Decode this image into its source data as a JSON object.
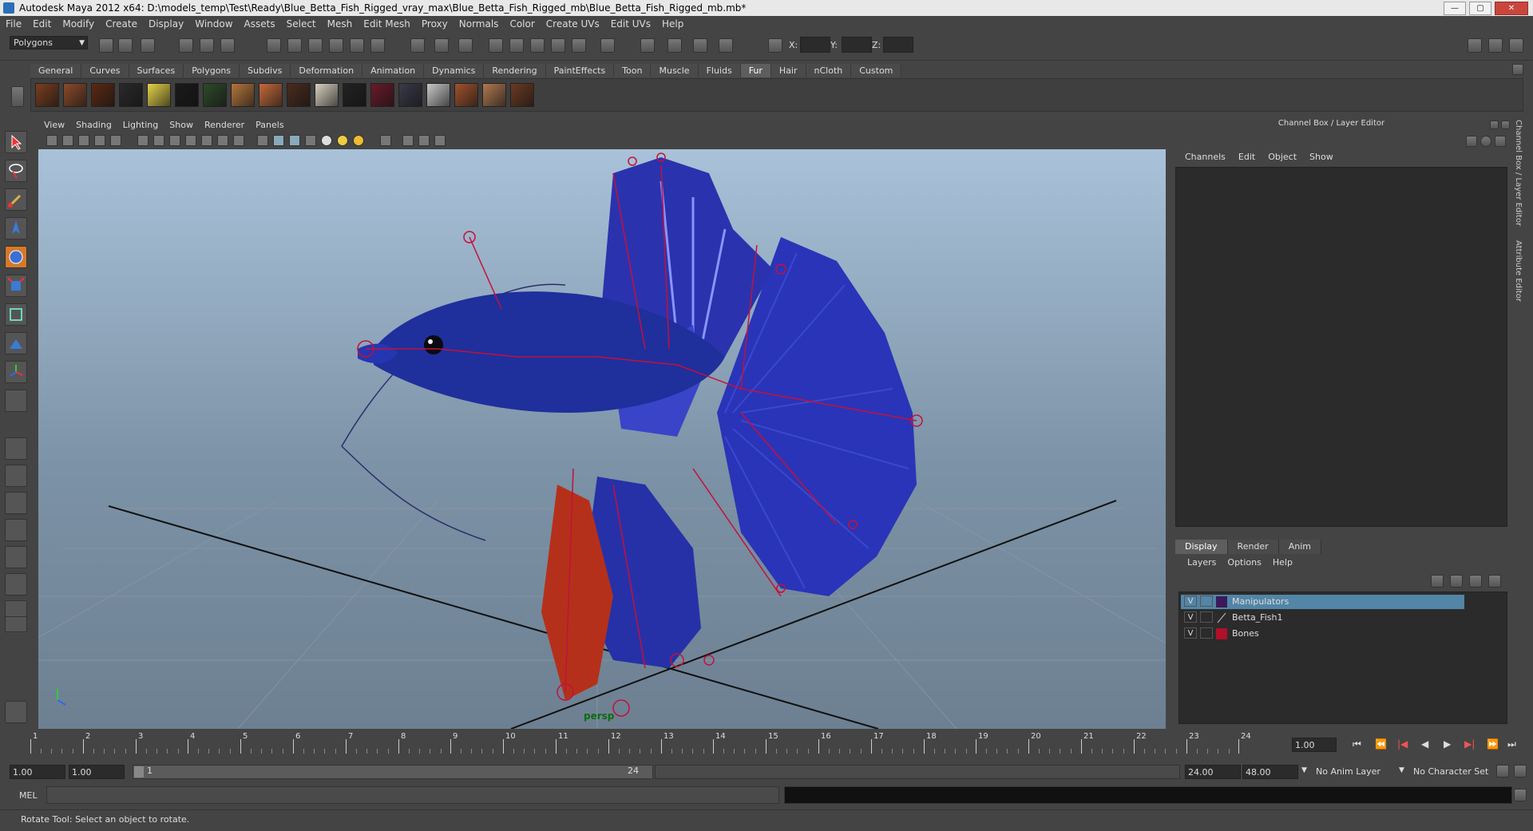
{
  "window": {
    "title": "Autodesk Maya 2012 x64: D:\\models_temp\\Test\\Ready\\Blue_Betta_Fish_Rigged_vray_max\\Blue_Betta_Fish_Rigged_mb\\Blue_Betta_Fish_Rigged_mb.mb*",
    "minimize": "—",
    "maximize": "▢",
    "close": "✕"
  },
  "menubar": [
    "File",
    "Edit",
    "Modify",
    "Create",
    "Display",
    "Window",
    "Assets",
    "Select",
    "Mesh",
    "Edit Mesh",
    "Proxy",
    "Normals",
    "Color",
    "Create UVs",
    "Edit UVs",
    "Help"
  ],
  "status_line": {
    "mode": "Polygons",
    "x_label": "X:",
    "y_label": "Y:",
    "z_label": "Z:"
  },
  "shelf": {
    "tabs": [
      "General",
      "Curves",
      "Surfaces",
      "Polygons",
      "Subdivs",
      "Deformation",
      "Animation",
      "Dynamics",
      "Rendering",
      "PaintEffects",
      "Toon",
      "Muscle",
      "Fluids",
      "Fur",
      "Hair",
      "nCloth",
      "Custom"
    ],
    "active_tab": "Fur",
    "fur_swatch_colors": [
      "#7a3e1e",
      "#8c4a2a",
      "#5a2a14",
      "#2a2a2a",
      "#e6d24a",
      "#1a1a1a",
      "#2e4a2a",
      "#b5763d",
      "#c46a3a",
      "#4a2c1e",
      "#d8d0c0",
      "#222222",
      "#6a1a2a",
      "#3a3a4a",
      "#c8c8c8",
      "#a0522d",
      "#b07850",
      "#6b3a22"
    ]
  },
  "viewport": {
    "menu": [
      "View",
      "Shading",
      "Lighting",
      "Show",
      "Renderer",
      "Panels"
    ],
    "camera_label": "persp",
    "colors": {
      "fish_body": "#1f2f9c",
      "fin": "#2a34b8",
      "tail_red": "#b5301a",
      "rig": "#c4103c",
      "curve": "#2b2d6a"
    }
  },
  "channel_box": {
    "title": "Channel Box / Layer Editor",
    "menu": [
      "Channels",
      "Edit",
      "Object",
      "Show"
    ]
  },
  "layer_editor": {
    "tabs": [
      "Display",
      "Render",
      "Anim"
    ],
    "active_tab": "Display",
    "menu": [
      "Layers",
      "Options",
      "Help"
    ],
    "layers": [
      {
        "visible": "V",
        "name": "Manipulators",
        "color": "#3a1a5a",
        "selected": true
      },
      {
        "visible": "V",
        "name": "Betta_Fish1",
        "color": "",
        "selected": false
      },
      {
        "visible": "V",
        "name": "Bones",
        "color": "#b0102a",
        "selected": false
      }
    ]
  },
  "side_tabs": [
    "Channel Box / Layer Editor",
    "Attribute Editor"
  ],
  "timeline": {
    "ticks": [
      "1",
      "2",
      "3",
      "4",
      "5",
      "6",
      "7",
      "8",
      "9",
      "10",
      "11",
      "12",
      "13",
      "14",
      "15",
      "16",
      "17",
      "18",
      "19",
      "20",
      "21",
      "22",
      "23",
      "24"
    ],
    "current_frame": "1.00",
    "playback": {
      "go_start": "⏮",
      "step_back_key": "⏪",
      "step_back": "|◀",
      "play_back": "◀",
      "play_fwd": "▶",
      "step_fwd": "▶|",
      "step_fwd_key": "⏩",
      "go_end": "⏭"
    }
  },
  "range": {
    "start": "1.00",
    "playback_start": "1.00",
    "slider_low": "1",
    "slider_high": "24",
    "playback_end": "24.00",
    "end": "48.00",
    "anim_layer": "No Anim Layer",
    "character_set": "No Character Set"
  },
  "command_line": {
    "label": "MEL"
  },
  "help_line": {
    "text": "Rotate Tool: Select an object to rotate."
  }
}
